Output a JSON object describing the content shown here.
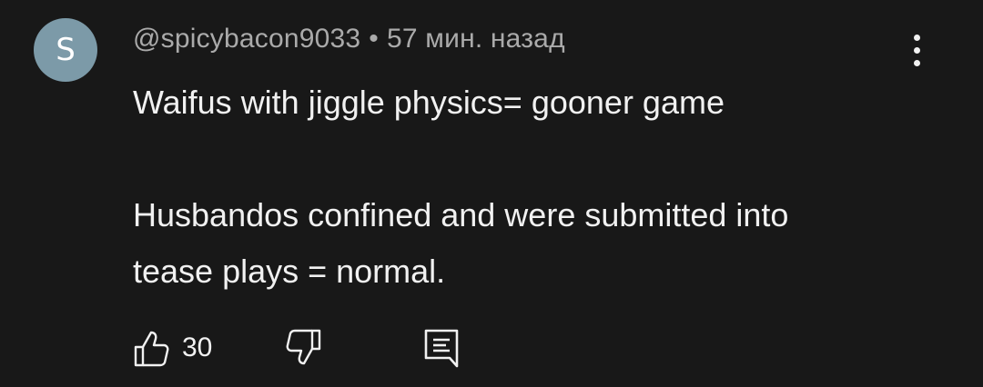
{
  "comment": {
    "avatar_letter": "S",
    "author": "@spicybacon9033",
    "separator": "•",
    "timestamp": "57 мин. назад",
    "paragraph1": "Waifus with jiggle physics= gooner game",
    "paragraph2_line1": "Husbandos confined and were submitted into",
    "paragraph2_line2": "tease plays = normal.",
    "like_count": "30",
    "icons": {
      "like": "thumbs-up-icon",
      "dislike": "thumbs-down-icon",
      "reply": "reply-comment-icon",
      "more": "more-vertical-icon"
    },
    "colors": {
      "background": "#181818",
      "avatar": "#7c9aa8",
      "meta_text": "#aaaaaa",
      "body_text": "#f1f1f1"
    }
  }
}
